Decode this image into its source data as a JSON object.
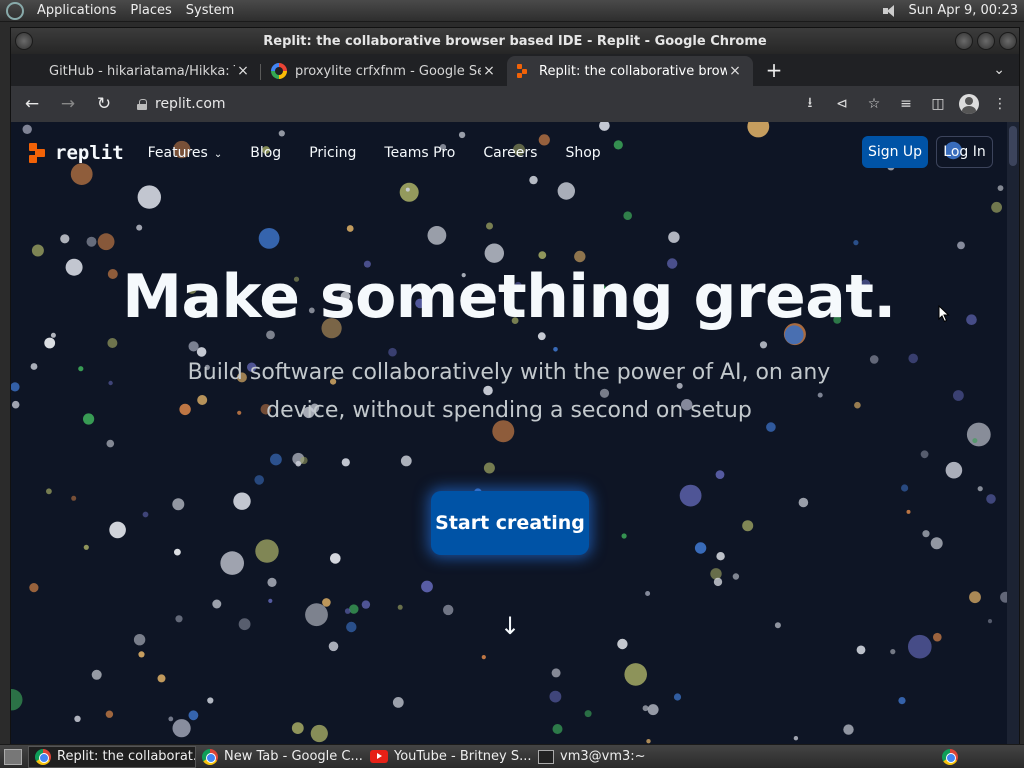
{
  "top_panel": {
    "menus": [
      "Applications",
      "Places",
      "System"
    ],
    "datetime": "Sun Apr  9, 00:23"
  },
  "window": {
    "title": "Replit: the collaborative browser based IDE - Replit - Google Chrome"
  },
  "tabs": [
    {
      "label": "GitHub - hikariatama/Hikka: T",
      "icon": "github-icon",
      "close": "×"
    },
    {
      "label": "proxylite crfxfnm - Google Sea",
      "icon": "google-icon",
      "close": "×"
    },
    {
      "label": "Replit: the collaborative brows",
      "icon": "replit-icon",
      "close": "×"
    }
  ],
  "toolbar": {
    "url": "replit.com",
    "new_tab": "+",
    "tab_search": "⌄"
  },
  "site": {
    "brand": "replit",
    "nav": [
      {
        "label": "Features",
        "has_dropdown": true
      },
      {
        "label": "Blog"
      },
      {
        "label": "Pricing"
      },
      {
        "label": "Teams Pro"
      },
      {
        "label": "Careers"
      },
      {
        "label": "Shop"
      }
    ],
    "signup": "Sign Up",
    "login": "Log In",
    "hero_title": "Make something great.",
    "hero_subtitle": "Build software collaboratively with the power of AI, on any device, without spending a second on setup",
    "cta": "Start creating",
    "colors": {
      "background": "#0e1525",
      "accent": "#0053a6",
      "brand": "#f26207"
    }
  },
  "taskbar": {
    "tasks": [
      {
        "label": "Replit: the collaborat...",
        "icon": "chrome-icon",
        "active": true
      },
      {
        "label": "New Tab - Google C...",
        "icon": "chrome-icon",
        "active": false
      },
      {
        "label": "YouTube - Britney S...",
        "icon": "youtube-icon",
        "active": false
      },
      {
        "label": "vm3@vm3:~",
        "icon": "terminal-icon",
        "active": false
      }
    ]
  }
}
